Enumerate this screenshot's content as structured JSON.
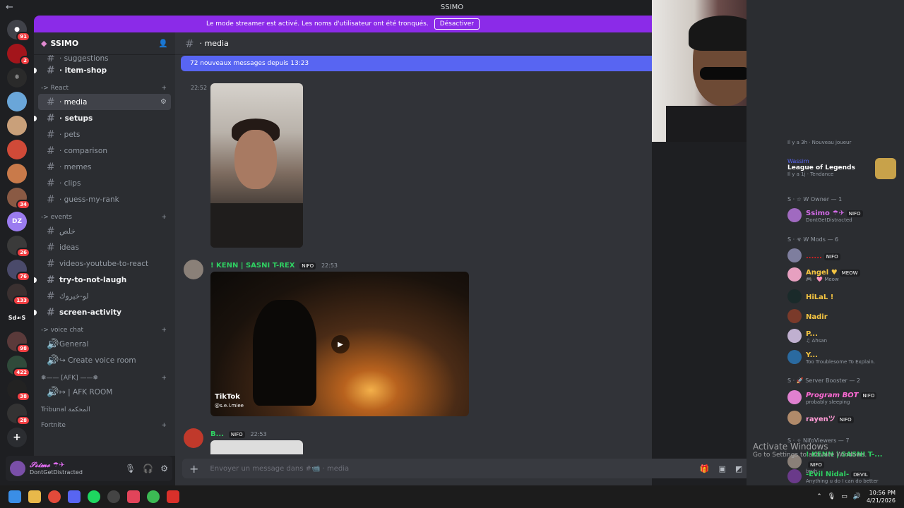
{
  "window": {
    "back": "←",
    "forward": "→",
    "title": "SSIMO"
  },
  "banner": {
    "text": "Le mode streamer est activé. Les noms d'utilisateur ont été tronqués.",
    "button": "Désactiver"
  },
  "guilds": {
    "badges": [
      "91",
      "2",
      "34",
      "26",
      "76",
      "133",
      "98",
      "422",
      "38",
      "28"
    ],
    "sd_label": "Sd☙S"
  },
  "server": {
    "name": "SSIMO"
  },
  "channels": [
    {
      "name": "· suggestions"
    },
    {
      "name": "· item-shop"
    },
    {
      "name": "-> React"
    },
    {
      "name": "· media"
    },
    {
      "name": "· setups"
    },
    {
      "name": "· pets"
    },
    {
      "name": "· comparison"
    },
    {
      "name": "· memes"
    },
    {
      "name": "· clips"
    },
    {
      "name": "· guess-my-rank"
    },
    {
      "name": "-> events"
    },
    {
      "name": "خلص"
    },
    {
      "name": "ideas"
    },
    {
      "name": "videos-youtube-to-react"
    },
    {
      "name": "try-to-not-laugh"
    },
    {
      "name": "لو-خيروك"
    },
    {
      "name": "screen-activity"
    },
    {
      "name": "-> voice chat"
    },
    {
      "name": "General"
    },
    {
      "name": "↪ Create voice room"
    },
    {
      "name": "❅—— [AFK] ——❅"
    },
    {
      "name": "↦ | AFK ROOM"
    },
    {
      "name": "Tribunal المحكمة"
    },
    {
      "name": "Fortnite"
    }
  ],
  "user": {
    "name": "𝓢𝓼𝓲𝓶𝓸 ☂✈",
    "status": "DontGetDistracted"
  },
  "chat": {
    "channel": "· media",
    "new_messages": "72 nouveaux messages depuis 13:23",
    "time1": "22:52",
    "msg2": {
      "author": "! KENN | SASNI T-REX",
      "tag": "NIFO",
      "time": "22:53",
      "tiktok": "TikTok",
      "handle": "@s.e.i.miee"
    },
    "msg3": {
      "author": "B...",
      "tag": "NIFO",
      "time": "22:53"
    },
    "composer_placeholder": "Envoyer un message dans #📹 · media"
  },
  "members": {
    "activity_top": "Il y a 3h  ·  Nouveau joueur",
    "activity_user": "Wassim",
    "activity_game": "League of Legends",
    "activity_meta": "Il y a 1j  ·  Tendance",
    "owner_head": "S · ☆ W Owner — 1",
    "owner": {
      "name": "Ssimo ☂✈",
      "tag": "NIFO",
      "status": "DontGetDistracted"
    },
    "mods_head": "S · ☣ W Mods — 6",
    "mods": [
      {
        "name": "......",
        "tag": "NIFO",
        "status": ""
      },
      {
        "name": "Angel ♥",
        "tag": "MEOW",
        "status": "🎮 · 🩷 Meow"
      },
      {
        "name": "HiLaL !",
        "tag": "",
        "status": ""
      },
      {
        "name": "Nadir",
        "tag": "",
        "status": ""
      },
      {
        "name": "P...",
        "tag": "",
        "status": "♫ Ahsan"
      },
      {
        "name": "Y...",
        "tag": "",
        "status": "Too Troublesome To Explain."
      }
    ],
    "booster_head": "S · 🚀 Server Booster — 2",
    "boosters": [
      {
        "name": "Program BOT",
        "tag": "NIFO",
        "status": "probably sleeping"
      },
      {
        "name": "rayenツ",
        "tag": "NIFO",
        "status": ""
      }
    ],
    "viewers_head": "S · ✧ NifoViewers — 7",
    "viewers": [
      {
        "name": "! KENN | SASNI T-...",
        "tag": "NIFO",
        "status": "bruh"
      },
      {
        "name": "-Evil Nidal-",
        "tag": "DEVIL",
        "status": "Anything u do I can do better"
      }
    ]
  },
  "watermark": {
    "line1": "Activate Windows",
    "line2": "Go to Settings to activate Windows."
  },
  "taskbar": {
    "time": "10:56 PM",
    "date": "4/21/2026"
  }
}
